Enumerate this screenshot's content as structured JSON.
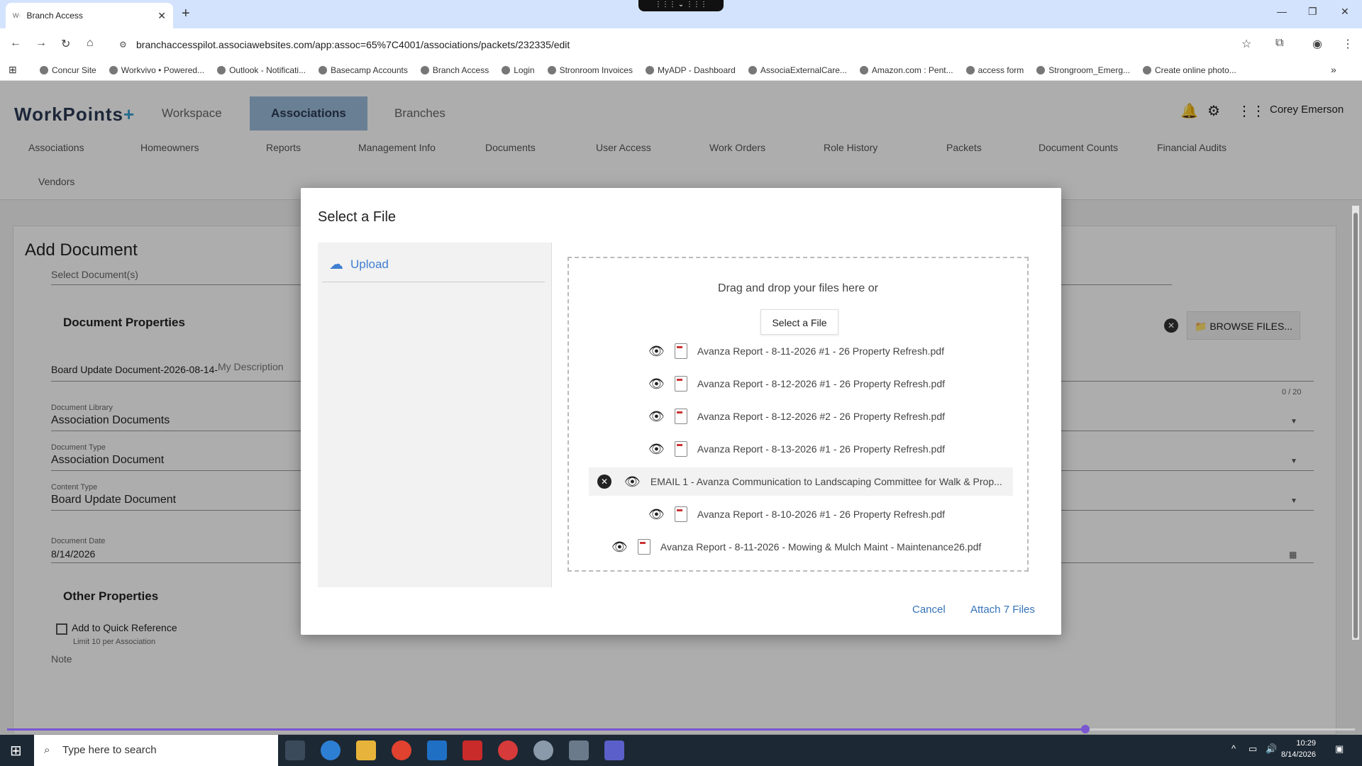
{
  "browser": {
    "tab_title": "Branch Access",
    "tab_favicon": "W·",
    "url": "branchaccesspilot.associawebsites.com/app:assoc=65%7C4001/associations/packets/232335/edit",
    "bookmarks": [
      "Concur Site",
      "Workvivo • Powered...",
      "Outlook - Notificati...",
      "Basecamp Accounts",
      "Branch Access",
      "Login",
      "Stronroom Invoices",
      "MyADP - Dashboard",
      "AssociaExternalCare...",
      "Amazon.com : Pent...",
      "access form",
      "Strongroom_Emerg...",
      "Create online photo..."
    ]
  },
  "app": {
    "logo_main": "WorkPoints",
    "logo_plus": "+",
    "main_nav": [
      "Workspace",
      "Associations",
      "Branches"
    ],
    "active_nav": "Associations",
    "user_name": "Corey Emerson",
    "sub_nav": [
      "Associations",
      "Homeowners",
      "Reports",
      "Management Info",
      "Documents",
      "User Access",
      "Work Orders",
      "Role History",
      "Packets",
      "Document Counts",
      "Financial Audits",
      "Vendors"
    ]
  },
  "page": {
    "title": "Add Document",
    "select_documents_label": "Select Document(s)",
    "browse_button": "BROWSE FILES...",
    "document_properties_title": "Document Properties",
    "document_name_prefix": "Board Update Document-2026-08-14-",
    "description_placeholder": "My Description",
    "char_count": "0 / 20",
    "document_library_label": "Document Library",
    "document_library_value": "Association Documents",
    "document_type_label": "Document Type",
    "document_type_value": "Association Document",
    "content_type_label": "Content Type",
    "content_type_value": "Board Update Document",
    "document_date_label": "Document Date",
    "document_date_value": "8/14/2026",
    "other_properties_title": "Other Properties",
    "quick_reference_label": "Add to Quick Reference",
    "quick_reference_hint": "Limit 10 per Association",
    "note_label": "Note"
  },
  "modal": {
    "title": "Select a File",
    "upload_label": "Upload",
    "drag_text": "Drag and drop your files here or",
    "select_file_button": "Select a File",
    "files": [
      {
        "name": "Avanza Report - 8-11-2026 #1 - 26 Property Refresh.pdf",
        "type": "pdf"
      },
      {
        "name": "Avanza Report - 8-12-2026 #1 - 26 Property Refresh.pdf",
        "type": "pdf"
      },
      {
        "name": "Avanza Report - 8-12-2026 #2 - 26 Property Refresh.pdf",
        "type": "pdf"
      },
      {
        "name": "Avanza Report - 8-13-2026 #1 - 26 Property Refresh.pdf",
        "type": "pdf"
      },
      {
        "name": "EMAIL 1 - Avanza Communication to Landscaping Committee for Walk & Prop...",
        "type": "email"
      },
      {
        "name": "Avanza Report - 8-10-2026 #1 - 26 Property Refresh.pdf",
        "type": "pdf"
      },
      {
        "name": "Avanza Report - 8-11-2026 - Mowing & Mulch Maint - Maintenance26.pdf",
        "type": "pdf"
      }
    ],
    "cancel_button": "Cancel",
    "attach_button": "Attach 7 Files"
  },
  "video": {
    "time": "4:02 / 5:00",
    "progress": 0.8
  },
  "taskbar": {
    "search_placeholder": "Type here to search",
    "time": "10:29",
    "date": "8/14/2026"
  },
  "colors": {
    "accent_link": "#3573b8",
    "active_nav_bg": "#9bbbd9",
    "progress": "#7a57d1"
  }
}
